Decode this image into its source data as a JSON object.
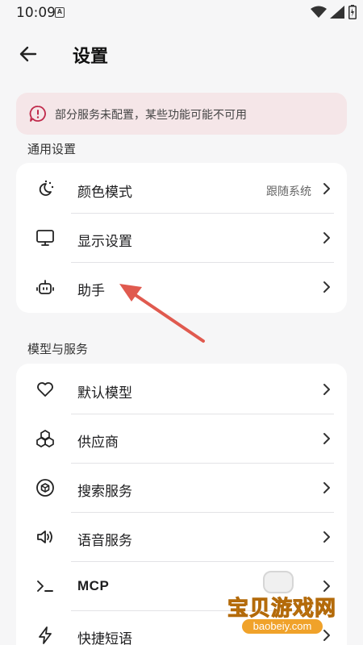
{
  "status": {
    "time": "10:09",
    "notif_glyph": "A"
  },
  "appbar": {
    "title": "设置"
  },
  "warning": {
    "text": "部分服务未配置，某些功能可能不可用",
    "color": "#f5e6e8",
    "icon": "alert-bubble-icon"
  },
  "sections": {
    "general": {
      "title": "通用设置",
      "items": [
        {
          "label": "颜色模式",
          "value": "跟随系统",
          "icon": "color-mode-icon"
        },
        {
          "label": "显示设置",
          "value": "",
          "icon": "monitor-icon"
        },
        {
          "label": "助手",
          "value": "",
          "icon": "robot-icon"
        }
      ]
    },
    "models": {
      "title": "模型与服务",
      "items": [
        {
          "label": "默认模型",
          "icon": "heart-icon"
        },
        {
          "label": "供应商",
          "icon": "boxes-icon"
        },
        {
          "label": "搜索服务",
          "icon": "search-globe-icon"
        },
        {
          "label": "语音服务",
          "icon": "speaker-icon"
        },
        {
          "label": "MCP",
          "icon": "terminal-icon"
        },
        {
          "label": "快捷短语",
          "icon": "bolt-icon"
        }
      ]
    }
  },
  "watermark": {
    "name": "宝贝游戏网",
    "url": "baobeiy.com"
  },
  "colors": {
    "accent_arrow": "#e05a4f",
    "card": "#ffffff",
    "background": "#f6f6f7"
  }
}
